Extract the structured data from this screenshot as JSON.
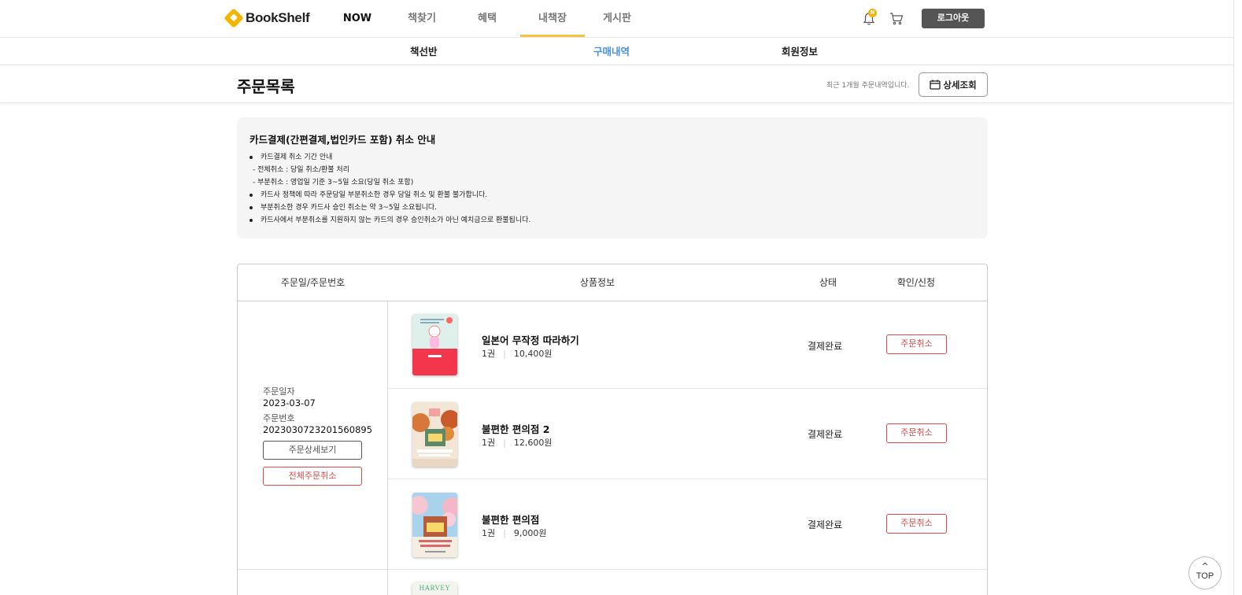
{
  "brand": {
    "name": "BookShelf",
    "accent": "#f5b400"
  },
  "nav": {
    "items": [
      {
        "label": "NOW"
      },
      {
        "label": "책찾기"
      },
      {
        "label": "혜택"
      },
      {
        "label": "내책장"
      },
      {
        "label": "게시판"
      }
    ],
    "active": "내책장",
    "notification_badge": "N",
    "logout_label": "로그아웃"
  },
  "subnav": {
    "items": [
      {
        "label": "책선반"
      },
      {
        "label": "구매내역"
      },
      {
        "label": "회원정보"
      }
    ],
    "active": "구매내역",
    "active_color": "#4a90e2"
  },
  "titlebar": {
    "title": "주문목록",
    "recent_note": "최근 1개월 주문내역입니다.",
    "detail_button": "상세조회"
  },
  "notice": {
    "title": "카드결제(간편결제,법인카드 포함) 취소 안내",
    "lines": [
      "카드결제 취소 기간 안내",
      "- 전체취소 : 당일 취소/환불 처리",
      "- 부분취소 : 영업일 기준 3~5일 소요(당일 취소 포함)",
      "카드사 정책에 따라 주문당일 부분취소한 경우 당일 취소 및 환불 불가합니다.",
      "부분취소한 경우 카드사 승인 취소는 약 3~5일 소요됩니다.",
      "카드사에서 부분취소를 지원하지 않는 카드의 경우 승인취소가 아닌 예치금으로 환불됩니다."
    ]
  },
  "table": {
    "headers": [
      "주문일/주문번호",
      "상품정보",
      "상태",
      "확인/신청"
    ],
    "order": {
      "date_label": "주문일자",
      "date": "2023-03-07",
      "number_label": "주문번호",
      "number": "2023030723201560895",
      "detail_button": "주문상세보기",
      "cancel_all_button": "전체주문취소",
      "items": [
        {
          "title": "일본어 무작정 따라하기",
          "qty": "1권",
          "price": "10,400원",
          "status": "결제완료",
          "action": "주문취소"
        },
        {
          "title": "불편한 편의점 2",
          "qty": "1권",
          "price": "12,600원",
          "status": "결제완료",
          "action": "주문취소"
        },
        {
          "title": "불편한 편의점",
          "qty": "1권",
          "price": "9,000원",
          "status": "결제완료",
          "action": "주문취소"
        }
      ]
    },
    "next_cover_text": "HARVEY"
  },
  "top_button": {
    "caret": "^",
    "label": "TOP"
  }
}
